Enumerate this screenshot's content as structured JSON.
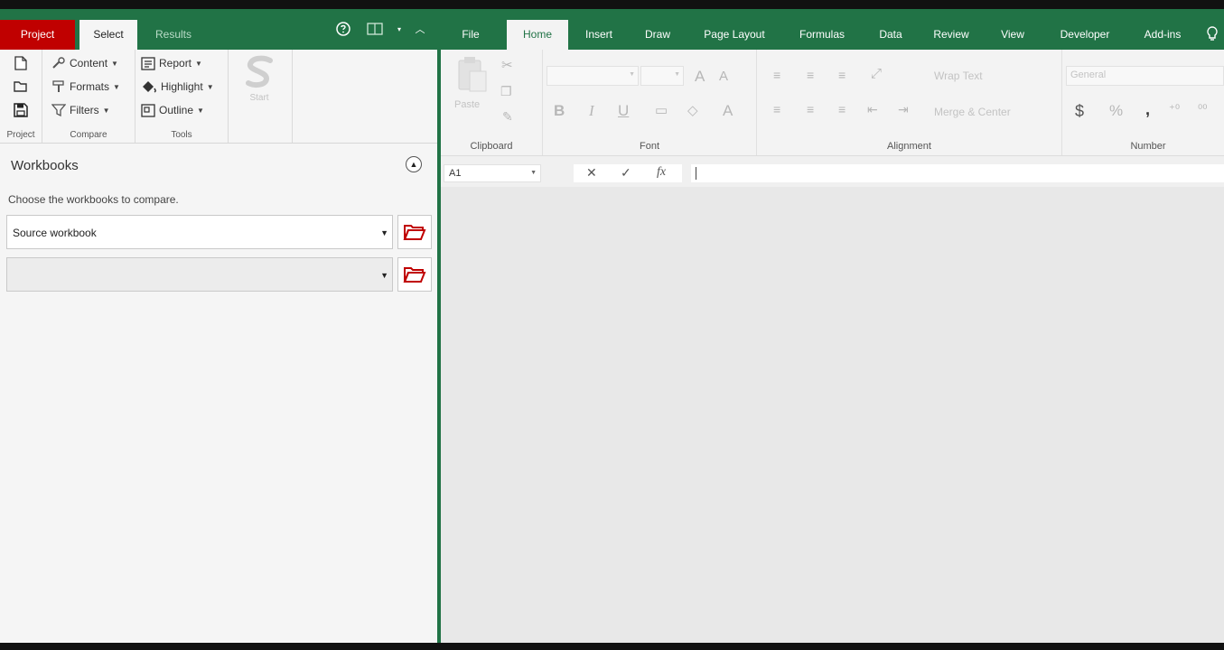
{
  "left": {
    "tabs": {
      "project": "Project",
      "select": "Select",
      "results": "Results"
    },
    "ribbon": {
      "project_group": "Project",
      "compare_group": "Compare",
      "tools_group": "Tools",
      "content": "Content",
      "formats": "Formats",
      "filters": "Filters",
      "report": "Report",
      "highlight": "Highlight",
      "outline": "Outline",
      "start": "Start"
    },
    "panel": {
      "title": "Workbooks",
      "description": "Choose the workbooks to compare.",
      "source_value": "Source workbook",
      "target_value": ""
    }
  },
  "excel": {
    "tabs": [
      "File",
      "Home",
      "Insert",
      "Draw",
      "Page Layout",
      "Formulas",
      "Data",
      "Review",
      "View",
      "Developer",
      "Add-ins"
    ],
    "active_tab": "Home",
    "ribbon": {
      "paste": "Paste",
      "clipboard": "Clipboard",
      "font": "Font",
      "alignment": "Alignment",
      "number": "Number",
      "wrap_text": "Wrap Text",
      "merge_center": "Merge & Center",
      "number_format": "General",
      "bold": "B",
      "italic": "I",
      "underline": "U",
      "currency": "$",
      "percent": "%",
      "comma": ",",
      "grow_font": "A",
      "shrink_font": "A",
      "font_color": "A"
    },
    "formula_bar": {
      "name_box": "A1",
      "fx": "fx",
      "cancel": "✕",
      "enter": "✓",
      "value": ""
    }
  },
  "colors": {
    "excel_green": "#217346",
    "project_red": "#c00000",
    "folder_red": "#c00000"
  }
}
